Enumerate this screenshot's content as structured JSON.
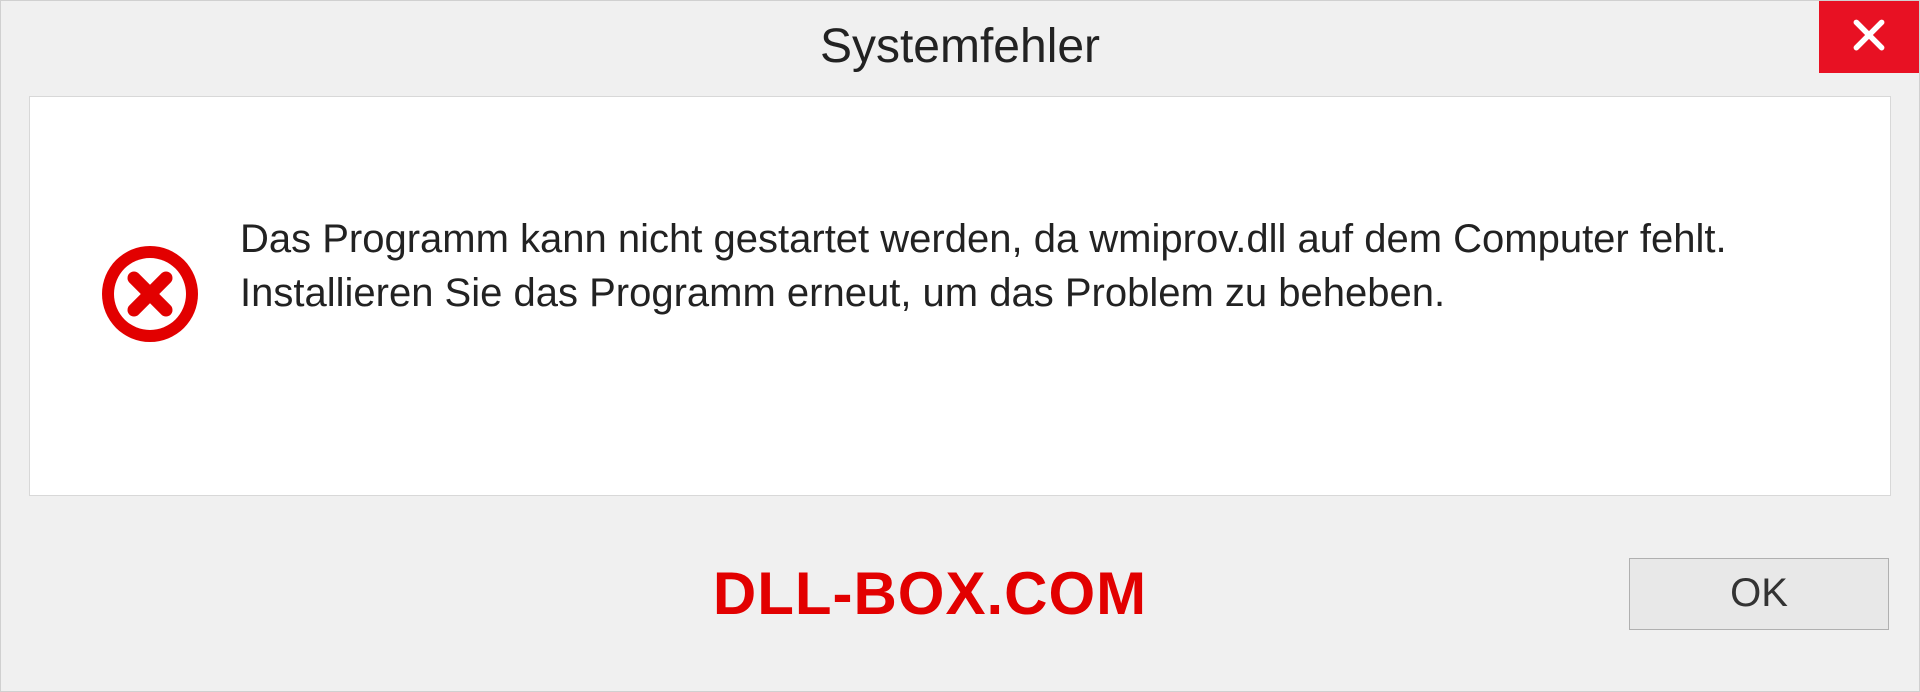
{
  "dialog": {
    "title": "Systemfehler",
    "message": "Das Programm kann nicht gestartet werden, da wmiprov.dll auf dem Computer fehlt. Installieren Sie das Programm erneut, um das Problem zu beheben.",
    "ok_label": "OK"
  },
  "watermark": "DLL-BOX.COM"
}
